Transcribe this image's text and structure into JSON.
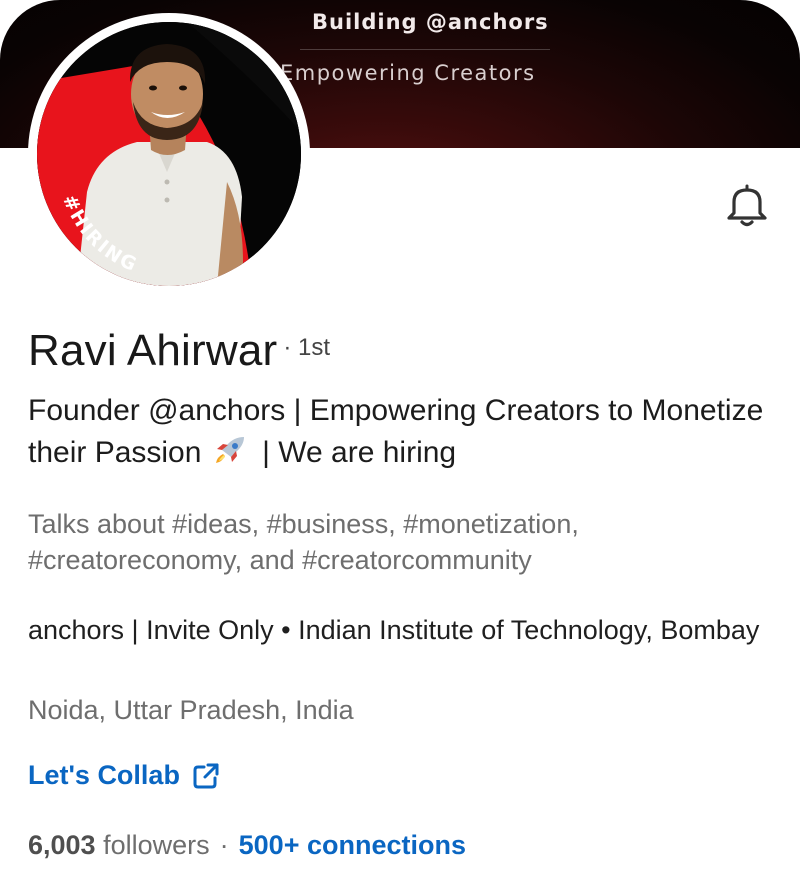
{
  "banner": {
    "title": "Building @anchors",
    "subtitle": "Empowering Creators"
  },
  "avatar": {
    "badge_text": "#HIRING"
  },
  "profile": {
    "name": "Ravi Ahirwar",
    "degree": "· 1st",
    "headline_part1": "Founder @anchors | Empowering Creators to Monetize their Passion",
    "headline_part2": "| We are hiring",
    "talks_about": "Talks about #ideas, #business, #monetization, #creatoreconomy, and #creatorcommunity",
    "organization": "anchors | Invite Only • Indian Institute of Technology, Bombay",
    "location": "Noida, Uttar Pradesh, India",
    "link_label": "Let's Collab"
  },
  "stats": {
    "followers_count": "6,003",
    "followers_label": "followers",
    "separator": "·",
    "connections": "500+ connections"
  },
  "icons": {
    "bell": "bell-icon",
    "external_link": "external-link-icon",
    "rocket": "rocket-emoji"
  },
  "colors": {
    "link_blue": "#0a66c2",
    "hiring_purple": "#7b3fc6",
    "banner_dark": "#0a0404"
  }
}
